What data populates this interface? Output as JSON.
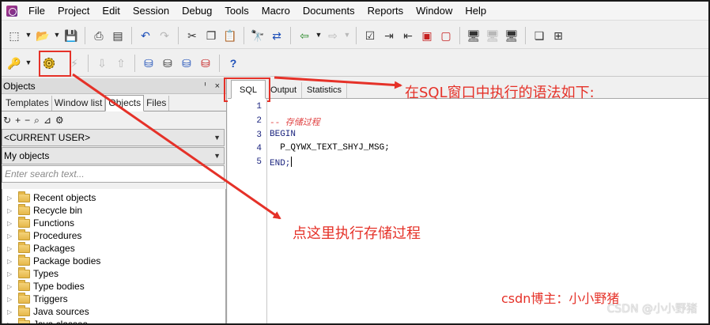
{
  "menu": [
    "File",
    "Project",
    "Edit",
    "Session",
    "Debug",
    "Tools",
    "Macro",
    "Documents",
    "Reports",
    "Window",
    "Help"
  ],
  "panel": {
    "title": "Objects",
    "controls": "ᑊ ×",
    "tabs": [
      "Templates",
      "Window list",
      "Objects",
      "Files"
    ],
    "user_combo": "<CURRENT USER>",
    "objects_combo": "My objects",
    "search_placeholder": "Enter search text...",
    "tree": [
      "Recent objects",
      "Recycle bin",
      "Functions",
      "Procedures",
      "Packages",
      "Package bodies",
      "Types",
      "Type bodies",
      "Triggers",
      "Java sources",
      "Java classes"
    ]
  },
  "editor": {
    "tabs": [
      "SQL",
      "Output",
      "Statistics"
    ],
    "line_numbers": [
      "1",
      "2",
      "3",
      "4",
      "5"
    ],
    "line2": "-- 存储过程",
    "line3": "BEGIN",
    "line4": "  P_QYWX_TEXT_SHYJ_MSG;",
    "line5": "END;"
  },
  "toolbar": {
    "sql_label": "SQL"
  },
  "annotations": {
    "sql_window": "在SQL窗口中执行的语法如下:",
    "execute_here": "点这里执行存储过程",
    "author": "csdn博主：小小野猪"
  },
  "watermark": "CSDN @小小野猪",
  "colors": {
    "annotation": "#e53128",
    "keyword": "#1a237e",
    "comment": "#e04040"
  }
}
